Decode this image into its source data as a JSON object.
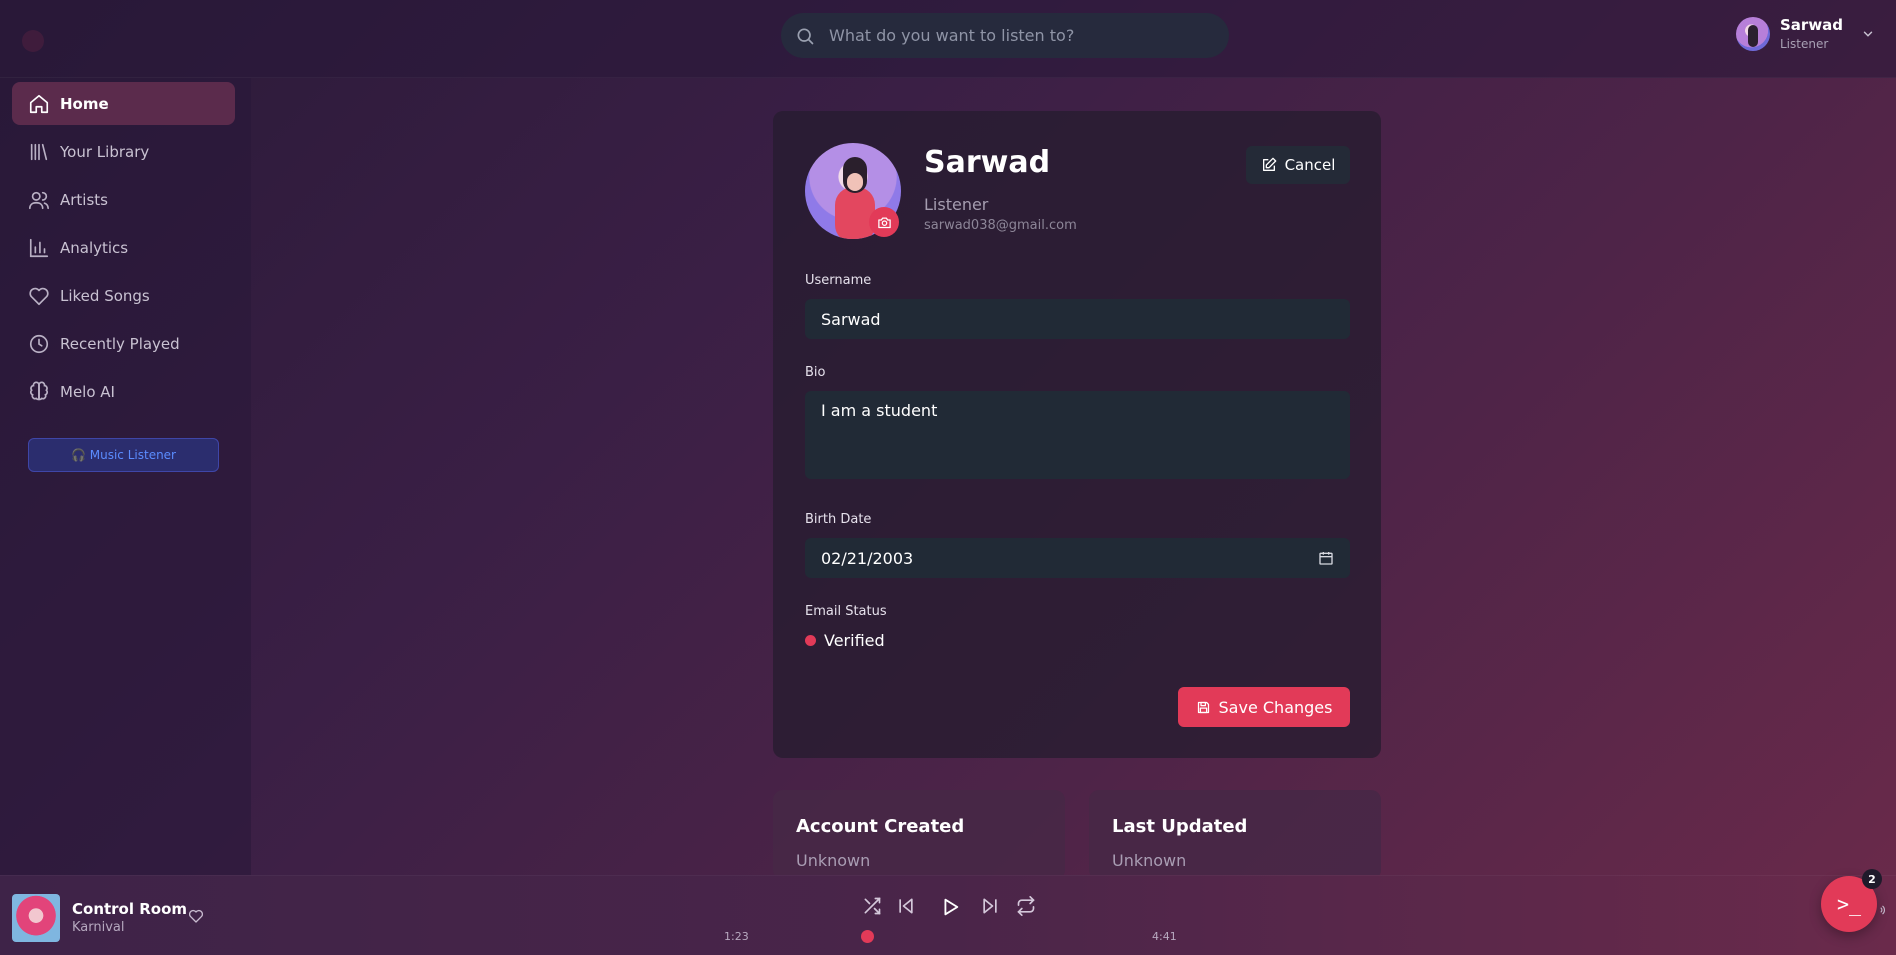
{
  "colors": {
    "accent": "#e23a58",
    "input_bg": "#212a36",
    "active_nav": "#5b2b4c",
    "listener_badge": "#5b8cff"
  },
  "search": {
    "placeholder": "What do you want to listen to?",
    "icon": "search-icon"
  },
  "user": {
    "name": "Sarwad",
    "role": "Listener"
  },
  "sidebar": {
    "items": [
      {
        "label": "Home",
        "icon": "home-icon",
        "active": true
      },
      {
        "label": "Your Library",
        "icon": "library-icon"
      },
      {
        "label": "Artists",
        "icon": "users-icon"
      },
      {
        "label": "Analytics",
        "icon": "bar-chart-icon"
      },
      {
        "label": "Liked Songs",
        "icon": "heart-icon"
      },
      {
        "label": "Recently Played",
        "icon": "clock-icon"
      },
      {
        "label": "Melo AI",
        "icon": "brain-icon"
      }
    ],
    "badge": "🎧 Music Listener"
  },
  "profile": {
    "name": "Sarwad",
    "role": "Listener",
    "email": "sarwad038@gmail.com",
    "cancel_label": "Cancel",
    "username_label": "Username",
    "username_value": "Sarwad",
    "bio_label": "Bio",
    "bio_value": "I am a student",
    "birth_label": "Birth Date",
    "birth_value": "02/21/2003",
    "email_status_label": "Email Status",
    "email_status_value": "Verified",
    "save_label": "Save Changes"
  },
  "meta_cards": {
    "created_title": "Account Created",
    "created_value": "Unknown",
    "updated_title": "Last Updated",
    "updated_value": "Unknown"
  },
  "player": {
    "title": "Control Room",
    "artist": "Karnival",
    "elapsed": "1:23",
    "duration": "4:41",
    "progress": 0.295
  },
  "fab": {
    "label": ">_",
    "badge": "2"
  }
}
